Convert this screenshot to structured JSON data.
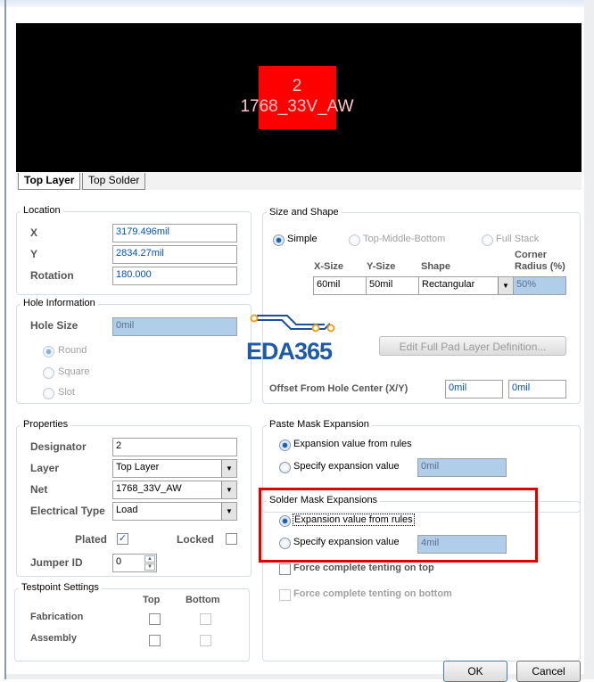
{
  "preview": {
    "pad_number": "2",
    "pad_net": "1768_33V_AW"
  },
  "tabs": [
    {
      "label": "Top Layer"
    },
    {
      "label": "Top Solder"
    }
  ],
  "location": {
    "title": "Location",
    "x_label": "X",
    "x": "3179.496mil",
    "y_label": "Y",
    "y": "2834.27mil",
    "rotation_label": "Rotation",
    "rotation": "180.000"
  },
  "hole": {
    "title": "Hole Information",
    "size_label": "Hole Size",
    "size": "0mil",
    "round": "Round",
    "square": "Square",
    "slot": "Slot"
  },
  "size_shape": {
    "title": "Size and Shape",
    "simple": "Simple",
    "tmb": "Top-Middle-Bottom",
    "full_stack": "Full Stack",
    "x_size_h": "X-Size",
    "y_size_h": "Y-Size",
    "shape_h": "Shape",
    "corner_h1": "Corner",
    "corner_h2": "Radius (%)",
    "x_size": "60mil",
    "y_size": "50mil",
    "shape": "Rectangular",
    "corner": "50%",
    "edit_button": "Edit Full Pad Layer Definition...",
    "offset_label": "Offset From Hole Center (X/Y)",
    "offset_x": "0mil",
    "offset_y": "0mil"
  },
  "logo": {
    "text": "EDA365"
  },
  "properties": {
    "title": "Properties",
    "designator_label": "Designator",
    "designator": "2",
    "layer_label": "Layer",
    "layer": "Top Layer",
    "net_label": "Net",
    "net": "1768_33V_AW",
    "etype_label": "Electrical Type",
    "etype": "Load",
    "plated_label": "Plated",
    "locked_label": "Locked",
    "jumper_label": "Jumper ID",
    "jumper": "0"
  },
  "testpoint": {
    "title": "Testpoint Settings",
    "top": "Top",
    "bottom": "Bottom",
    "fabrication": "Fabrication",
    "assembly": "Assembly"
  },
  "paste": {
    "title": "Paste Mask Expansion",
    "from_rules": "Expansion value from rules",
    "specify": "Specify expansion value",
    "value": "0mil"
  },
  "solder": {
    "title": "Solder Mask Expansions",
    "from_rules": "Expansion value from rules",
    "specify": "Specify expansion value",
    "value": "4mil",
    "tent_top": "Force complete tenting on top",
    "tent_bottom": "Force complete tenting on bottom"
  },
  "buttons": {
    "ok": "OK",
    "cancel": "Cancel"
  },
  "colors": {
    "highlight": "#e00000",
    "pad": "#ff0000"
  }
}
